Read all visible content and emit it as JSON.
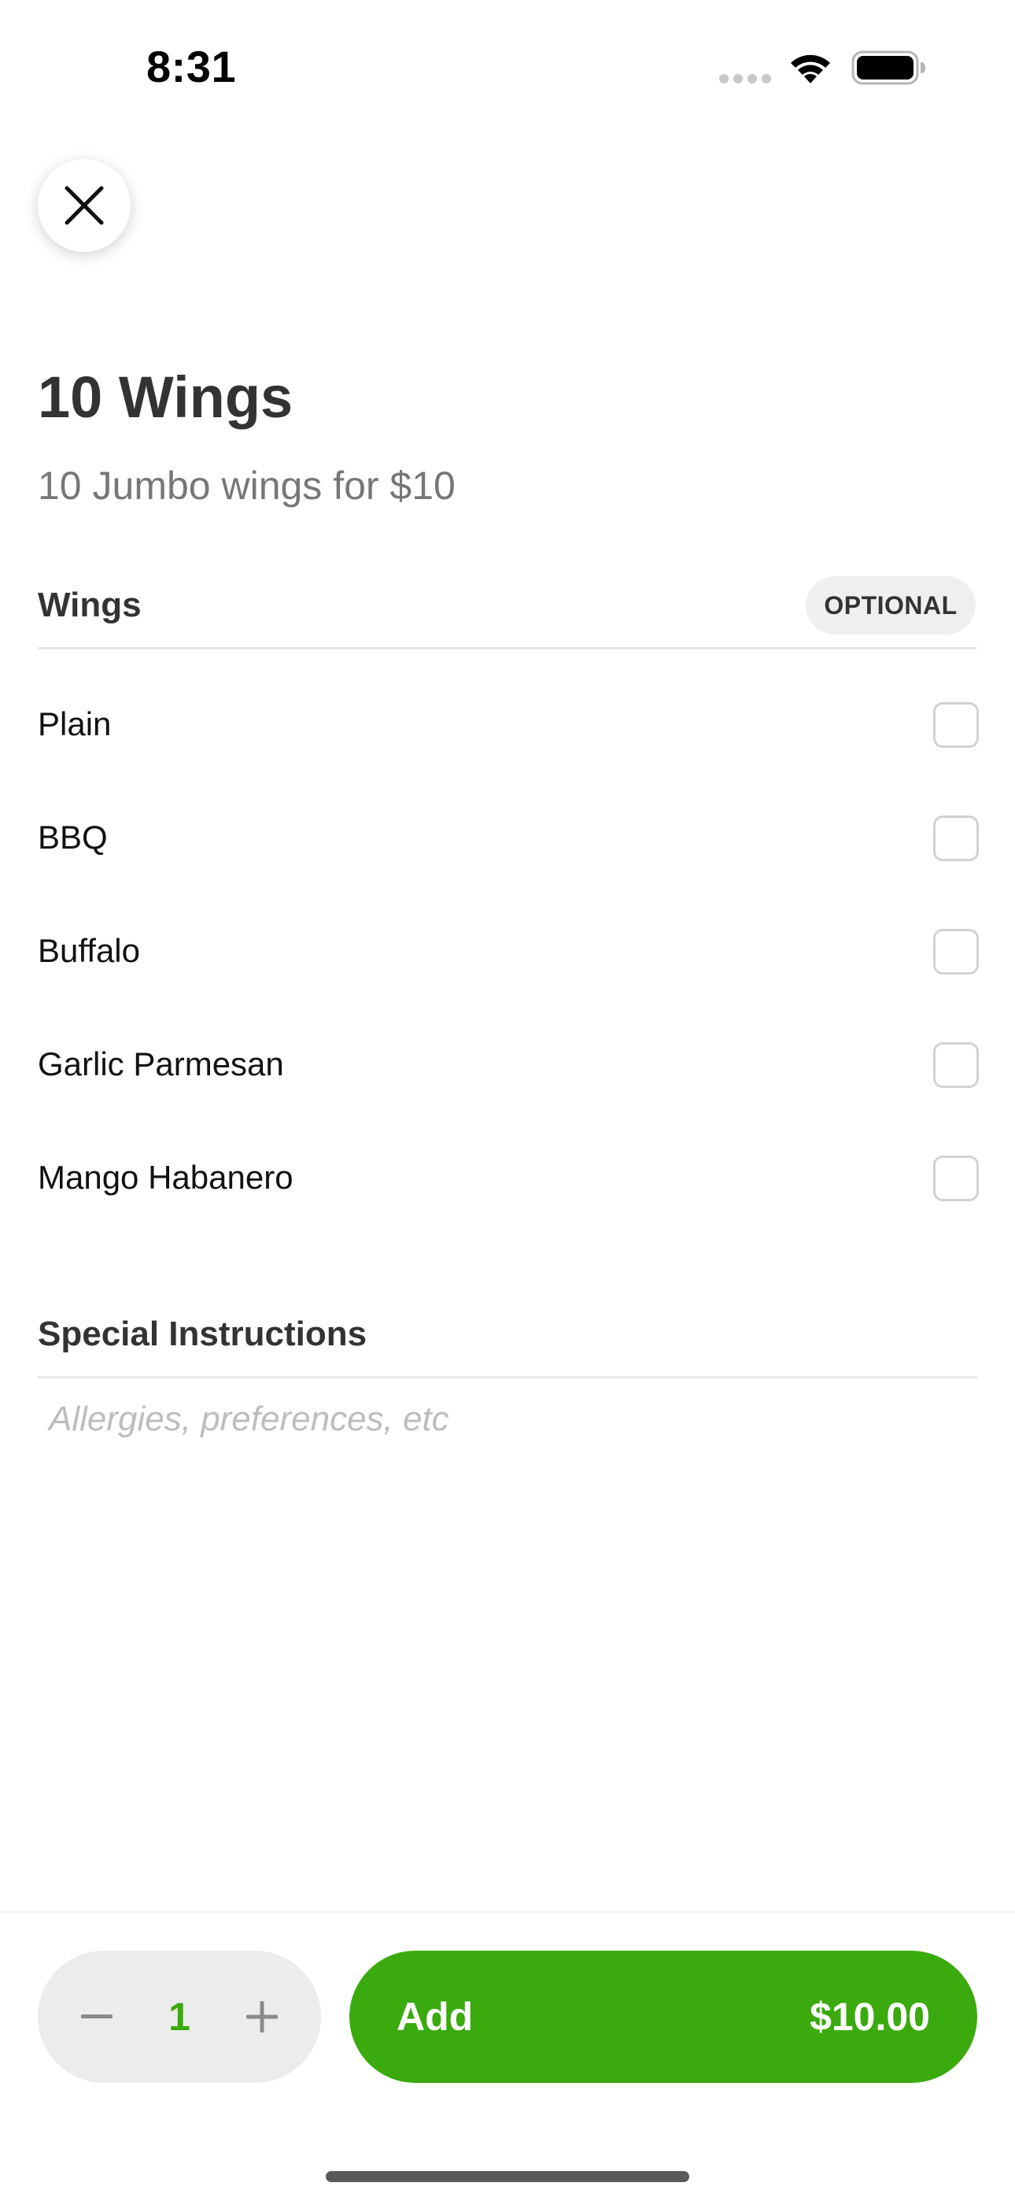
{
  "status_bar": {
    "time": "8:31",
    "icons": [
      "signal-icon",
      "wifi-icon",
      "battery-icon"
    ]
  },
  "close_icon": "close-icon",
  "item": {
    "title": "10 Wings",
    "description": "10 Jumbo wings for $10"
  },
  "wings_section": {
    "title": "Wings",
    "badge": "OPTIONAL",
    "options": [
      {
        "label": "Plain",
        "checked": false
      },
      {
        "label": "BBQ",
        "checked": false
      },
      {
        "label": "Buffalo",
        "checked": false
      },
      {
        "label": "Garlic Parmesan",
        "checked": false
      },
      {
        "label": "Mango Habanero",
        "checked": false
      }
    ]
  },
  "instructions": {
    "title": "Special Instructions",
    "placeholder": "Allergies, preferences, etc"
  },
  "bottom_bar": {
    "quantity": "1",
    "add_label": "Add",
    "price": "$10.00"
  },
  "colors": {
    "accent": "#3aaa0e",
    "text": "#333333",
    "muted": "#777777"
  }
}
